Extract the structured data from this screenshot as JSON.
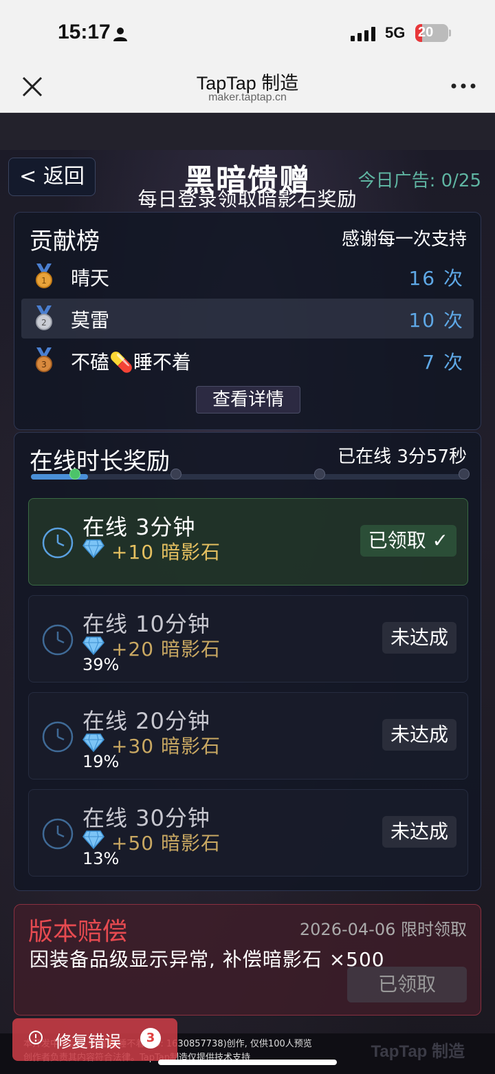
{
  "status_bar": {
    "time": "15:17",
    "network": "5G",
    "battery": "20",
    "battery_level": 0.2
  },
  "nav": {
    "title": "TapTap 制造",
    "subtitle": "maker.taptap.cn"
  },
  "header": {
    "back_label": "< 返回",
    "title": "黑暗馈赠",
    "ad_count": "今日广告: 0/25",
    "subtitle": "每日登录领取暗影石奖励"
  },
  "ranking": {
    "title": "贡献榜",
    "thanks": "感谢每一次支持",
    "rows": [
      {
        "rank": "1",
        "name": "晴天",
        "count": "16 次"
      },
      {
        "rank": "2",
        "name": "莫雷",
        "count": "10 次"
      },
      {
        "rank": "3",
        "name": "不磕💊睡不着",
        "count": "7 次"
      }
    ],
    "detail_button": "查看详情"
  },
  "online": {
    "title": "在线时长奖励",
    "online_time": "已在线 3分57秒",
    "progress_fraction": 0.132,
    "rewards": [
      {
        "title": "在线 3分钟",
        "gain": "+10 暗影石",
        "percent": "",
        "status": "已领取 ✓"
      },
      {
        "title": "在线 10分钟",
        "gain": "+20 暗影石",
        "percent": "39%",
        "status": "未达成"
      },
      {
        "title": "在线 20分钟",
        "gain": "+30 暗影石",
        "percent": "19%",
        "status": "未达成"
      },
      {
        "title": "在线 30分钟",
        "gain": "+50 暗影石",
        "percent": "13%",
        "status": "未达成"
      }
    ]
  },
  "compensation": {
    "title": "版本赔偿",
    "date": "2026-04-06 限时领取",
    "description": "因装备品级显示异常, 补偿暗影石 ×500",
    "button": "已领取"
  },
  "footer": {
    "note_line1": "本开发中项目由 不磕💊睡不着 (ID: 1630857738)创作, 仅供100人预览",
    "note_line2": "创作者负责其内容符合法律。TapTap制造仅提供技术支持",
    "fix_label": "修复错误",
    "fix_count": "3",
    "brand": "TapTap 制造"
  },
  "colors": {
    "accent_blue": "#5ea8e6",
    "gold": "#e5c060",
    "red": "#e64a50",
    "green": "#4cc46a"
  }
}
